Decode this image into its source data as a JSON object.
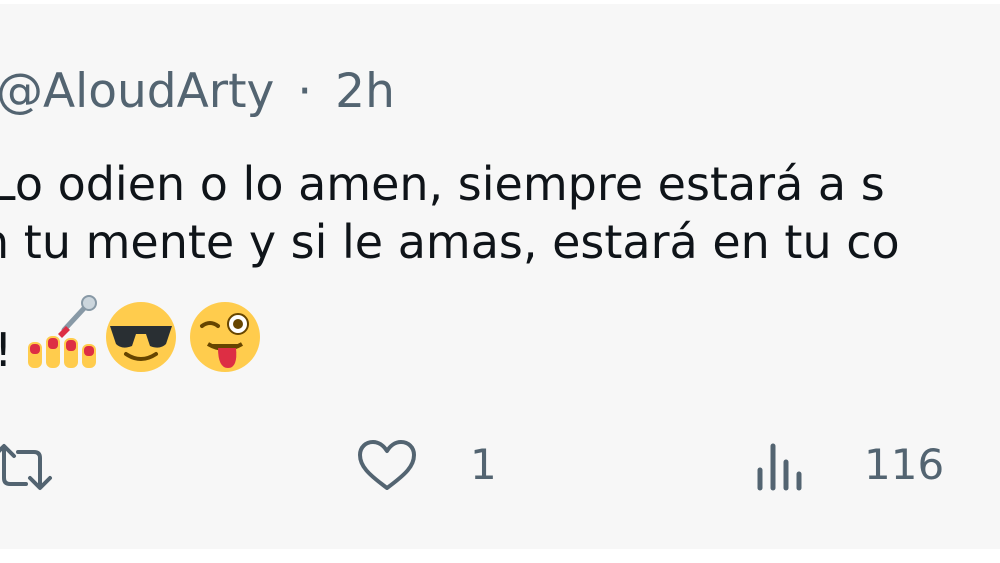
{
  "tweet": {
    "handle": "@AloudArty",
    "separator": "·",
    "time": "2h",
    "text_lines": [
      "Lo odien o lo amen, siempre estará a s",
      "n tu mente y si le amas, estará en tu co",
      "!"
    ],
    "emojis": [
      "nail-polish",
      "smiling-face-with-sunglasses",
      "winking-face-with-tongue"
    ]
  },
  "actions": {
    "retweet_icon": "retweet-icon",
    "like_icon": "heart-icon",
    "like_count": "1",
    "views_icon": "views-chart-icon",
    "views_count": "116"
  },
  "colors": {
    "background": "#f7f7f7",
    "text": "#0f1419",
    "secondary": "#536471",
    "emoji_yellow": "#ffcc4d",
    "nail_red": "#dd2e44"
  }
}
